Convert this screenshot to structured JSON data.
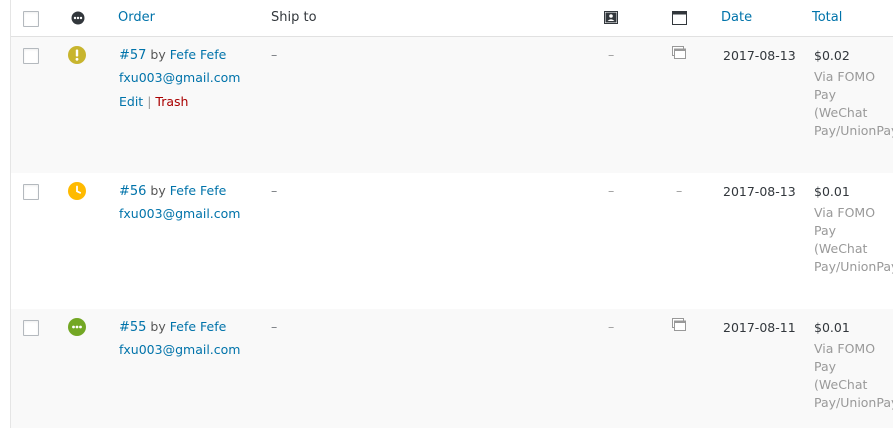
{
  "header": {
    "order_label": "Order",
    "ship_to_label": "Ship to",
    "date_label": "Date",
    "total_label": "Total",
    "status_icon": "status-dots-icon",
    "billing_icon": "billing-address-card-icon",
    "notes_icon": "customer-notes-window-icon"
  },
  "colors": {
    "link": "#0073aa",
    "trash": "#a00000",
    "status_processing": "#c8b52e",
    "status_pending": "#ffba00",
    "status_onhold": "#73a724"
  },
  "orders": [
    {
      "number": "#57",
      "by": "by",
      "customer": "Fefe Fefe",
      "email": "fxu003@gmail.com",
      "edit": "Edit",
      "sep": "|",
      "trash": "Trash",
      "ship_to": "–",
      "billing": "–",
      "date": "2017-08-13",
      "total": "$0.02",
      "via": "Via FOMO Pay (WeChat Pay/UnionPay)",
      "status_icon": "exclamation-icon",
      "notes_icon": "note-window-icon"
    },
    {
      "number": "#56",
      "by": "by",
      "customer": "Fefe Fefe",
      "email": "fxu003@gmail.com",
      "ship_to": "–",
      "billing": "–",
      "notes": "–",
      "date": "2017-08-13",
      "total": "$0.01",
      "via": "Via FOMO Pay (WeChat Pay/UnionPay)",
      "status_icon": "clock-icon"
    },
    {
      "number": "#55",
      "by": "by",
      "customer": "Fefe Fefe",
      "email": "fxu003@gmail.com",
      "ship_to": "–",
      "billing": "–",
      "date": "2017-08-11",
      "total": "$0.01",
      "via": "Via FOMO Pay (WeChat Pay/UnionPay)",
      "status_icon": "ellipsis-icon",
      "notes_icon": "note-window-icon"
    }
  ]
}
